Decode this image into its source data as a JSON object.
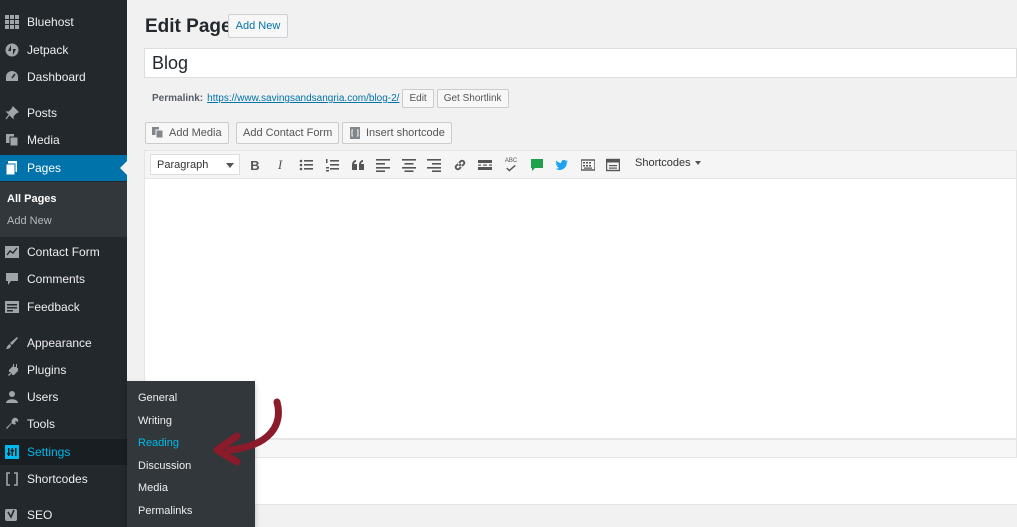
{
  "sidebar": {
    "items": [
      {
        "label": "Bluehost",
        "icon": "grid-icon"
      },
      {
        "label": "Jetpack",
        "icon": "jetpack-icon"
      },
      {
        "label": "Dashboard",
        "icon": "dashboard-icon"
      },
      {
        "label": "Posts",
        "icon": "pin-icon"
      },
      {
        "label": "Media",
        "icon": "media-icon"
      },
      {
        "label": "Pages",
        "icon": "pages-icon"
      },
      {
        "label": "Contact Form",
        "icon": "contact-form-icon"
      },
      {
        "label": "Comments",
        "icon": "comments-icon"
      },
      {
        "label": "Feedback",
        "icon": "feedback-icon"
      },
      {
        "label": "Appearance",
        "icon": "brush-icon"
      },
      {
        "label": "Plugins",
        "icon": "plugins-icon"
      },
      {
        "label": "Users",
        "icon": "users-icon"
      },
      {
        "label": "Tools",
        "icon": "wrench-icon"
      },
      {
        "label": "Settings",
        "icon": "settings-icon"
      },
      {
        "label": "Shortcodes",
        "icon": "brackets-icon"
      },
      {
        "label": "SEO",
        "icon": "seo-icon"
      }
    ],
    "pages_submenu": [
      "All Pages",
      "Add New"
    ],
    "settings_flyout": [
      "General",
      "Writing",
      "Reading",
      "Discussion",
      "Media",
      "Permalinks"
    ]
  },
  "editor_page": {
    "title": "Edit Page",
    "add_new": "Add New",
    "post_title": "Blog",
    "permalink_label": "Permalink:",
    "permalink_url": "https://www.savingsandsangria.com/blog-2/",
    "edit_btn": "Edit",
    "shortlink_btn": "Get Shortlink",
    "add_media": "Add Media",
    "add_contact_form": "Add Contact Form",
    "insert_shortcode": "Insert shortcode",
    "format_select": "Paragraph",
    "bold_glyph": "B",
    "italic_glyph": "I",
    "spell_glyph": "ABC",
    "shortcodes": "Shortcodes"
  },
  "colors": {
    "sidebar_bg": "#23282d",
    "accent": "#0073aa",
    "highlight_text": "#00b9eb",
    "arrow": "#8b1a2b"
  }
}
